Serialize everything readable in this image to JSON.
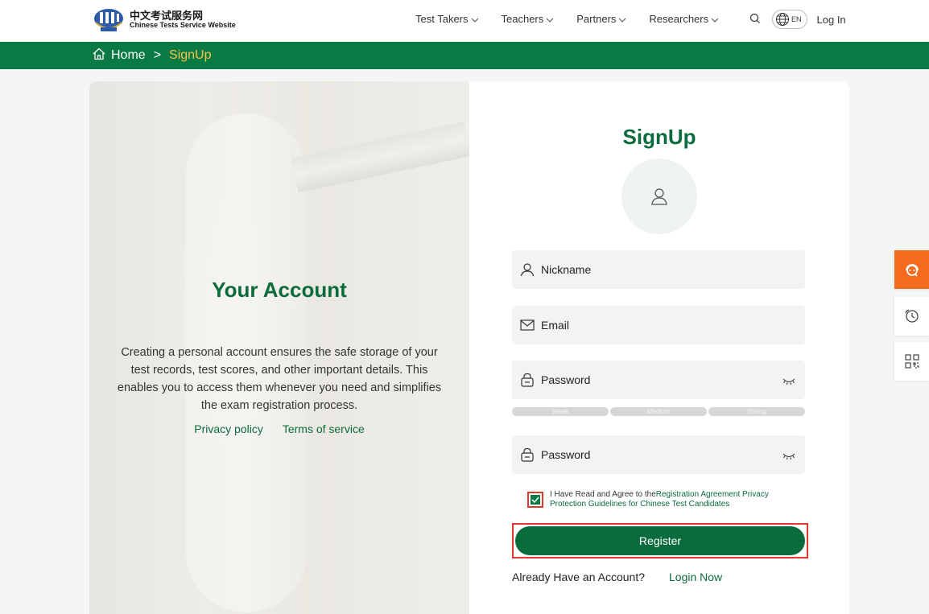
{
  "header": {
    "logo_cn": "中文考试服务网",
    "logo_en": "Chinese Tests Service Website",
    "nav": [
      {
        "label": "Test Takers"
      },
      {
        "label": "Teachers"
      },
      {
        "label": "Partners"
      },
      {
        "label": "Researchers"
      }
    ],
    "lang": "EN",
    "login": "Log In"
  },
  "breadcrumb": {
    "home": "Home",
    "separator": ">",
    "current": "SignUp"
  },
  "left_panel": {
    "title": "Your Account",
    "description": "Creating a personal account ensures the safe storage of your test records, test scores, and other important details. This enables you to access them whenever you need and simplifies the exam registration process.",
    "privacy": "Privacy policy",
    "terms": "Terms of service"
  },
  "form": {
    "title": "SignUp",
    "nickname": "Nickname",
    "email": "Email",
    "password": "Password",
    "confirm_password": "Password",
    "strength": [
      "Weak",
      "Medium",
      "Strong"
    ],
    "agree_prefix": "I Have Read and Agree to the",
    "agree_link": "Registration Agreement Privacy Protection Guidelines for Chinese Test Candidates",
    "agree_checked": true,
    "register": "Register",
    "already": "Already Have an Account?",
    "login_now": "Login Now"
  },
  "colors": {
    "brand_green": "#0a7a44",
    "accent_orange": "#f46b1d",
    "highlight_red": "#e0392b",
    "breadcrumb_current": "#f5c44a"
  }
}
